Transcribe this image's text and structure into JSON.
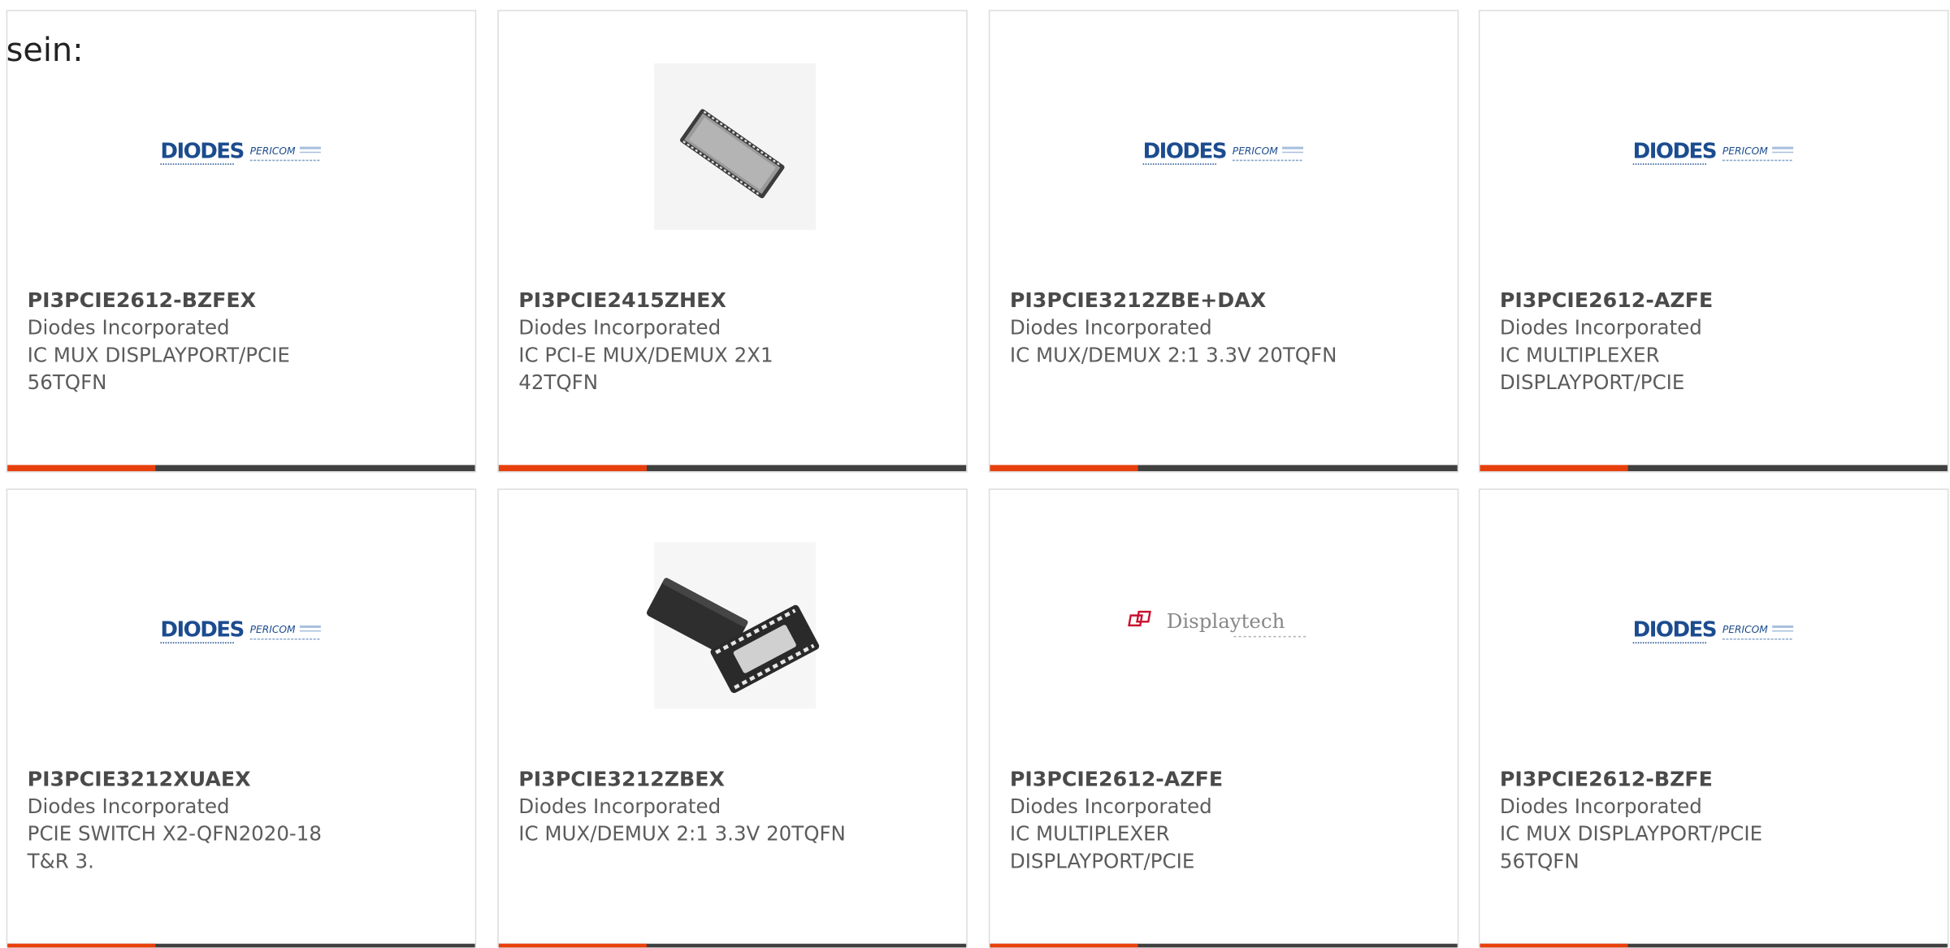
{
  "page": {
    "intro_text": "sein:"
  },
  "colors": {
    "card_border": "#dddddd",
    "bar_dark": "#404040",
    "bar_accent": "#e8400c",
    "diodes_blue": "#1c4c8f",
    "displaytech_red": "#c8102e"
  },
  "products": [
    {
      "part_number": "PI3PCIE2612-BZFEX",
      "manufacturer": "Diodes Incorporated",
      "description": "IC MUX DISPLAYPORT/PCIE 56TQFN",
      "image": "diodes-pericom-logo",
      "logo_main": "DIODES",
      "logo_sub": "PERICOM"
    },
    {
      "part_number": "PI3PCIE2415ZHEX",
      "manufacturer": "Diodes Incorporated",
      "description": "IC PCI-E MUX/DEMUX 2X1 42TQFN",
      "image": "chip-long-package"
    },
    {
      "part_number": "PI3PCIE3212ZBE+DAX",
      "manufacturer": "Diodes Incorporated",
      "description": "IC MUX/DEMUX 2:1 3.3V 20TQFN",
      "image": "diodes-pericom-logo",
      "logo_main": "DIODES",
      "logo_sub": "PERICOM"
    },
    {
      "part_number": "PI3PCIE2612-AZFE",
      "manufacturer": "Diodes Incorporated",
      "description": "IC MULTIPLEXER DISPLAYPORT/PCIE",
      "image": "diodes-pericom-logo",
      "logo_main": "DIODES",
      "logo_sub": "PERICOM"
    },
    {
      "part_number": "PI3PCIE3212XUAEX",
      "manufacturer": "Diodes Incorporated",
      "description": "PCIE SWITCH X2-QFN2020-18 T&R 3.",
      "image": "diodes-pericom-logo",
      "logo_main": "DIODES",
      "logo_sub": "PERICOM"
    },
    {
      "part_number": "PI3PCIE3212ZBEX",
      "manufacturer": "Diodes Incorporated",
      "description": "IC MUX/DEMUX 2:1 3.3V 20TQFN",
      "image": "chip-pair-package"
    },
    {
      "part_number": "PI3PCIE2612-AZFE",
      "manufacturer": "Diodes Incorporated",
      "description": "IC MULTIPLEXER DISPLAYPORT/PCIE",
      "image": "displaytech-logo",
      "logo_main": "Displaytech"
    },
    {
      "part_number": "PI3PCIE2612-BZFE",
      "manufacturer": "Diodes Incorporated",
      "description": "IC MUX DISPLAYPORT/PCIE 56TQFN",
      "image": "diodes-pericom-logo",
      "logo_main": "DIODES",
      "logo_sub": "PERICOM"
    }
  ]
}
